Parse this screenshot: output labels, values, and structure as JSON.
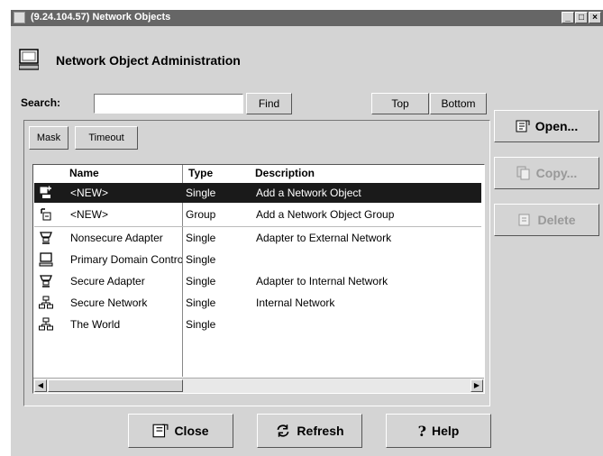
{
  "window": {
    "title": "(9.24.104.57) Network Objects"
  },
  "header": {
    "title": "Network Object Administration"
  },
  "search": {
    "label": "Search:",
    "value": "",
    "find_label": "Find",
    "top_label": "Top",
    "bottom_label": "Bottom"
  },
  "filters": {
    "mask_label": "Mask",
    "timeout_label": "Timeout"
  },
  "table": {
    "columns": [
      "Name",
      "Type",
      "Description"
    ],
    "rows": [
      {
        "name": "<NEW>",
        "type": "Single",
        "description": "Add a Network Object",
        "icon": "new-object-icon"
      },
      {
        "name": "<NEW>",
        "type": "Group",
        "description": "Add a Network Object Group",
        "icon": "new-group-icon"
      },
      {
        "name": "Nonsecure Adapter",
        "type": "Single",
        "description": "Adapter to External Network",
        "icon": "adapter-icon"
      },
      {
        "name": "Primary Domain Controller",
        "type": "Single",
        "description": "",
        "icon": "computer-icon"
      },
      {
        "name": "Secure Adapter",
        "type": "Single",
        "description": "Adapter to Internal Network",
        "icon": "adapter-icon"
      },
      {
        "name": "Secure Network",
        "type": "Single",
        "description": "Internal Network",
        "icon": "network-icon"
      },
      {
        "name": "The World",
        "type": "Single",
        "description": "",
        "icon": "network-icon"
      }
    ]
  },
  "actions": {
    "open_label": "Open...",
    "copy_label": "Copy...",
    "delete_label": "Delete"
  },
  "footer": {
    "close_label": "Close",
    "refresh_label": "Refresh",
    "help_label": "Help"
  }
}
